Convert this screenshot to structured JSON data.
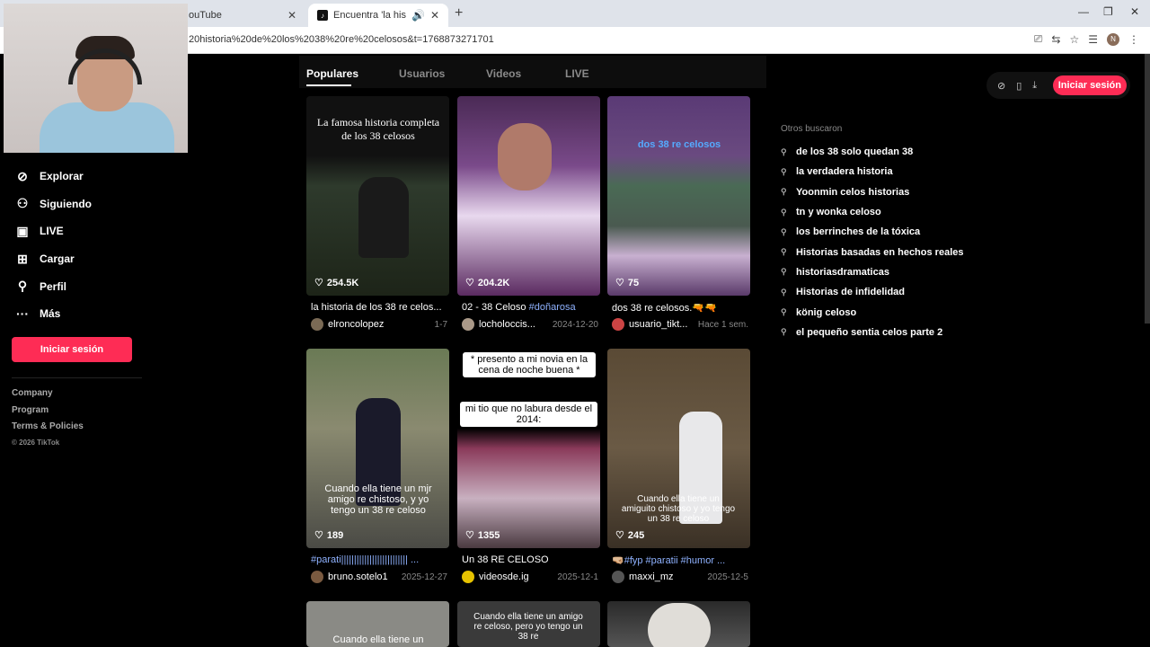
{
  "browser": {
    "tabs": [
      {
        "label": "ouTube"
      },
      {
        "label": "Encuentra 'la historia de los"
      }
    ],
    "url": "20historia%20de%20los%2038%20re%20celosos&t=1768873271701",
    "avatar_letter": "N"
  },
  "sidebar": {
    "items": [
      {
        "label": "Explorar",
        "icon": "compass-icon"
      },
      {
        "label": "Siguiendo",
        "icon": "user-plus-icon"
      },
      {
        "label": "LIVE",
        "icon": "live-icon"
      },
      {
        "label": "Cargar",
        "icon": "upload-icon"
      },
      {
        "label": "Perfil",
        "icon": "profile-icon"
      },
      {
        "label": "Más",
        "icon": "more-icon"
      }
    ],
    "login": "Iniciar sesión",
    "footer": [
      "Company",
      "Program",
      "Terms & Policies",
      "© 2026 TikTok"
    ]
  },
  "search_tabs": [
    "Populares",
    "Usuarios",
    "Videos",
    "LIVE"
  ],
  "header_actions": {
    "login": "Iniciar sesión"
  },
  "videos": [
    {
      "overlay": "La famosa historia completa de los 38 celosos",
      "likes": "254.5K",
      "desc": "la historia de los 38 re celos...",
      "tag": "",
      "user": "elroncolopez",
      "date": "1-7"
    },
    {
      "overlay": "",
      "likes": "204.2K",
      "desc": "02 - 38 Celoso ",
      "tag": "#doñarosa",
      "user": "locholoccis...",
      "date": "2024-12-20"
    },
    {
      "overlay": "dos 38 re celosos",
      "likes": "75",
      "desc": "dos 38 re celosos.🔫🔫",
      "tag": "",
      "user": "usuario_tikt...",
      "date": "Hace 1 sem."
    },
    {
      "overlay": "Cuando ella tiene un mjr amigo re chistoso, y yo tengo un 38 re celoso",
      "likes": "189",
      "desc": "",
      "tag": "#parati|||||||||||||||||||||||||| ...",
      "user": "bruno.sotelo1",
      "date": "2025-12-27"
    },
    {
      "overlay": "* presento a mi novia en la cena de noche buena *",
      "overlay2": "mi tio que no labura desde el 2014:",
      "likes": "1355",
      "desc": "Un 38 RE CELOSO",
      "tag": "",
      "user": "videosde.ig",
      "date": "2025-12-1"
    },
    {
      "overlay": "Cuando ella tiene un amiguito chistoso y yo tengo un 38 re celoso",
      "likes": "245",
      "desc": "🤜🏼",
      "tag": "#fyp #paratii #humor ...",
      "user": "maxxi_mz",
      "date": "2025-12-5"
    },
    {
      "overlay": "Cuando ella tiene un",
      "likes": "",
      "desc": "",
      "tag": "",
      "user": "",
      "date": ""
    },
    {
      "overlay": "Cuando ella tiene un amigo re celoso, pero yo tengo un 38 re",
      "likes": "",
      "desc": "",
      "tag": "",
      "user": "",
      "date": ""
    },
    {
      "overlay": "",
      "likes": "",
      "desc": "",
      "tag": "",
      "user": "",
      "date": ""
    }
  ],
  "others": {
    "title": "Otros buscaron",
    "items": [
      "de los 38 solo quedan 38",
      "la verdadera historia",
      "Yoonmin celos historias",
      "tn y wonka celoso",
      "los berrinches de la tóxica",
      "Historias basadas en hechos reales",
      "historiasdramaticas",
      "Historias de infidelidad",
      "könig celoso",
      "el pequeño sentia celos parte 2"
    ]
  },
  "colors": {
    "accent": "#fe2c55",
    "tag": "#8fb2ff"
  }
}
